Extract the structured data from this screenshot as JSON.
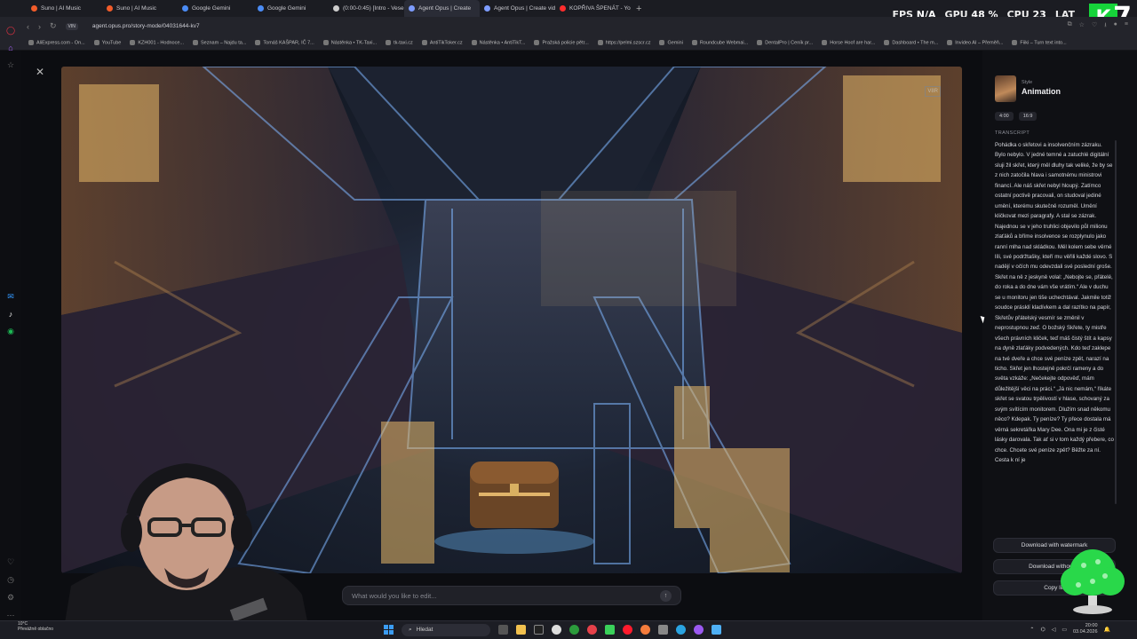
{
  "tabs": [
    {
      "label": "Suno | AI Music",
      "color": "#f25c2a"
    },
    {
      "label": "Suno | AI Music",
      "color": "#f25c2a"
    },
    {
      "label": "Google Gemini",
      "color": "#4b8cf5"
    },
    {
      "label": "Google Gemini",
      "color": "#4b8cf5"
    },
    {
      "label": "(0:00-0:45) [Intro - Vesel]",
      "color": "#cccccc"
    },
    {
      "label": "Agent Opus | Create",
      "color": "#7d9cff",
      "active": true
    },
    {
      "label": "Agent Opus | Create vide",
      "color": "#7d9cff"
    },
    {
      "label": "KOPŘIVA ŠPENÁT - YouTu",
      "color": "#ff2d2d"
    }
  ],
  "hud": {
    "fps_label": "FPS",
    "fps_value": "N/A",
    "gpu_label": "GPU",
    "gpu_value": "48 %",
    "cpu_label": "CPU",
    "cpu_value": "23",
    "extra": "LAT",
    "extra2": "/A"
  },
  "logo": {
    "k": "K",
    "seven": "7"
  },
  "address": {
    "badge": "VIN",
    "url": "agent.opus.pro/story-mode/04031644-kv7"
  },
  "bookmarks": [
    "AliExpress.com - On...",
    "YouTube",
    "KZH001 - Hodnoce...",
    "Seznam – Najdu ta...",
    "Tomáš KAŠPAR, IČ 7...",
    "Nástěnka • TK-Taxi...",
    "tk-taxi.cz",
    "AntiTikToker.cz",
    "Nástěnka • AntiTikT...",
    "Pražská policie pětr...",
    "https://pelmi.szscr.cz",
    "Gemini",
    "Roundcube Webmai...",
    "DentalPro | Ceník pr...",
    "Horse Hoof are har...",
    "Dashboard • The m...",
    "Invideo AI – Přeměň...",
    "Fiiki – Turn text into..."
  ],
  "video": {
    "watermark": "V8R"
  },
  "edit": {
    "placeholder": "What would you like to edit...",
    "send_icon": "↑"
  },
  "panel": {
    "style_label": "Style",
    "style_value": "Animation",
    "chips": [
      "4:00",
      "16:9"
    ],
    "transcript_label": "TRANSCRIPT",
    "transcript": "Pohádka o skřetovi a insolvenčním zázraku. Bylo nebylo. V jedné temné a zatuchlé digitální sluji žil skřet, který měl dluhy tak veliké, že by se z nich zatočila hlava i samotnému ministrovi financí. Ale náš skřet nebyl hloupý. Zatímco ostatní poctivě pracovali, on studoval jediné umění, kterému skutečně rozuměl. Umění kličkovat mezi paragrafy. A stal se zázrak. Najednou se v jeho truhlici objevilo půl milionu zlaťáků a bříme insolvence se rozplynulo jako ranní mlha nad skládkou. Měl kolem sebe věrné líli, své podržtašky, kteří mu věřili každé slovo. S nadějí v očích mu odevzdali své poslední groše. Skřet na ně z jeskyně volal: „Nebojte se, přátelé, do roka a do dne vám vše vrátím.“ Ale v duchu se u monitoru jen tiše uchechtával. Jakmile totiž soudce prásklí kladívkem a dal razítko na papír, Skřetův přátelský vesmír se změnil v neprostupnou zeď. O božský Skřete, ty mistře všech právních kliček, teď máš čistý štít a kapsy na dyně zlaťáky podvedených. Kdo teď zaklepe na tvé dveře a chce své peníze zpět, narazí na ticho. Skřet jen lhostejně pokrčí rameny a do světa vzkáže: „Nečekejte odpověď, mám důležitější věci na práci.“ „Já nic nemám,“ říkáte skřet se svatou trpělivostí v hlase, schovaný za svým svítícím monitorem. Dlužím snad někomu něco? Kdepak. Ty peníze? Ty přece dostala má věrná sekretářka Mary Dee. Ona mi je z čisté lásky darovala. Tak ať si v tom každý přebere, co chce. Chcete své peníze zpět? Běžte za ní. Cesta k ní je",
    "btn_watermark": "Download with watermark",
    "btn_no_watermark": "Download without w",
    "btn_copy": "Copy lin"
  },
  "taskbar": {
    "weather_temp": "10°C",
    "weather_text": "Převážně oblačno",
    "search": "Hledat",
    "time": "20:00",
    "date": "03.04.2026",
    "accent": "#3b9cf2"
  }
}
